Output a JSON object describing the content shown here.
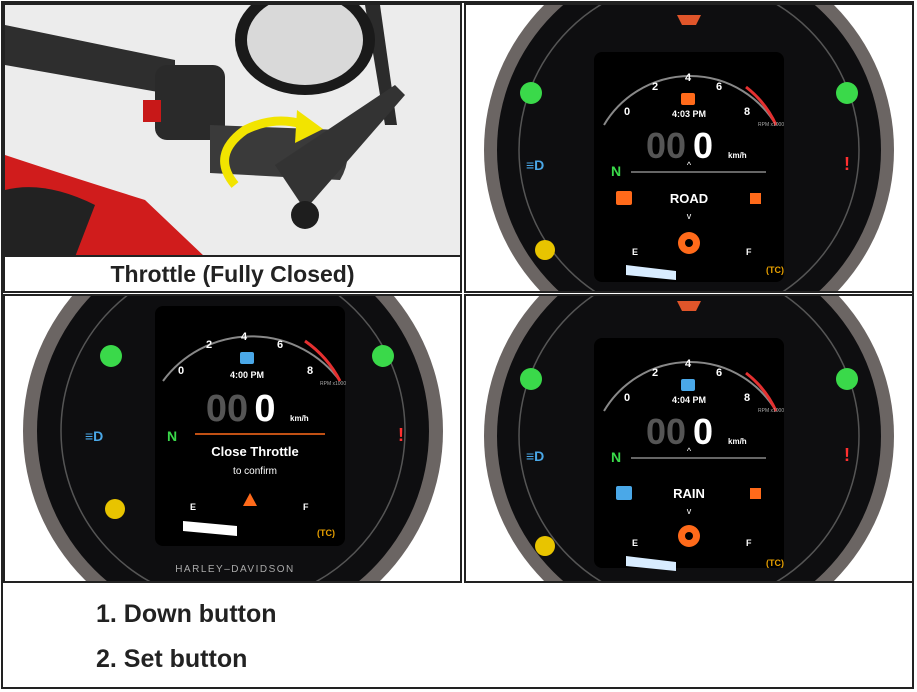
{
  "photo_caption": "Throttle (Fully Closed)",
  "display_road": {
    "time": "4:03 PM",
    "speed_dim": "00",
    "speed": "0",
    "unit": "km/h",
    "gear": "N",
    "mode": "ROAD",
    "rpm_unit": "RPM x1000",
    "ticks": [
      "0",
      "2",
      "4",
      "6",
      "8"
    ],
    "fuel_e": "E",
    "fuel_f": "F"
  },
  "display_close": {
    "time": "4:00 PM",
    "speed_dim": "00",
    "speed": "0",
    "unit": "km/h",
    "gear": "N",
    "title": "Close Throttle",
    "sub": "to confirm",
    "rpm_unit": "RPM x1000",
    "ticks": [
      "0",
      "2",
      "4",
      "6",
      "8"
    ],
    "fuel_e": "E",
    "fuel_f": "F",
    "bezel_brand": "HARLEY–DAVIDSON"
  },
  "display_rain": {
    "time": "4:04 PM",
    "speed_dim": "00",
    "speed": "0",
    "unit": "km/h",
    "gear": "N",
    "mode": "RAIN",
    "rpm_unit": "RPM x1000",
    "ticks": [
      "0",
      "2",
      "4",
      "6",
      "8"
    ],
    "fuel_e": "E",
    "fuel_f": "F"
  },
  "steps": [
    "1. Down button",
    "2. Set button"
  ],
  "colors": {
    "turn": "#3ad94a",
    "warn": "#ff3030",
    "abs": "#e8c400",
    "accent": "#ff6a1a",
    "blue": "#4aa8e8"
  }
}
